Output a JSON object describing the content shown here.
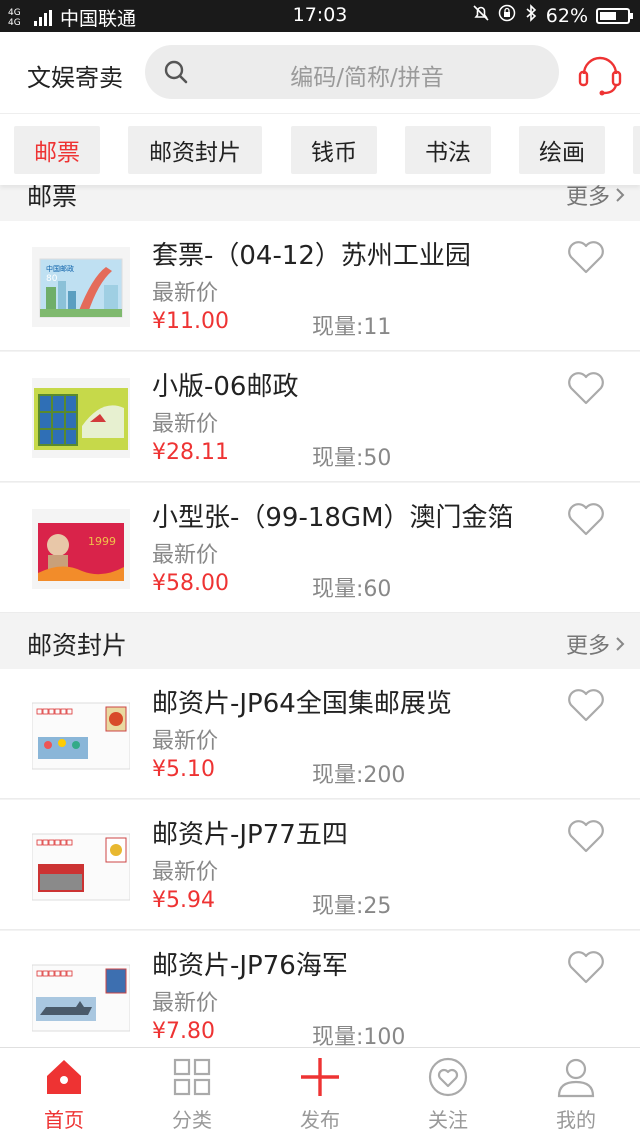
{
  "status_bar": {
    "network": "4G 4G",
    "carrier": "中国联通",
    "time": "17:03",
    "battery": "62%",
    "battery_level": 0.62
  },
  "header": {
    "brand": "文娱寄卖",
    "search_placeholder": "编码/简称/拼音"
  },
  "tabs": [
    {
      "label": "邮票",
      "active": true
    },
    {
      "label": "邮资封片",
      "active": false
    },
    {
      "label": "钱币",
      "active": false
    },
    {
      "label": "书法",
      "active": false
    },
    {
      "label": "绘画",
      "active": false
    }
  ],
  "sections": [
    {
      "title": "邮票",
      "more": "更多",
      "items": [
        {
          "title": "套票-（04-12）苏州工业园",
          "sub": "最新价",
          "price": "¥11.00",
          "stock": "现量:11"
        },
        {
          "title": "小版-06邮政",
          "sub": "最新价",
          "price": "¥28.11",
          "stock": "现量:50"
        },
        {
          "title": "小型张-（99-18GM）澳门金箔",
          "sub": "最新价",
          "price": "¥58.00",
          "stock": "现量:60"
        }
      ]
    },
    {
      "title": "邮资封片",
      "more": "更多",
      "items": [
        {
          "title": "邮资片-JP64全国集邮展览",
          "sub": "最新价",
          "price": "¥5.10",
          "stock": "现量:200"
        },
        {
          "title": "邮资片-JP77五四",
          "sub": "最新价",
          "price": "¥5.94",
          "stock": "现量:25"
        },
        {
          "title": "邮资片-JP76海军",
          "sub": "最新价",
          "price": "¥7.80",
          "stock": "现量:100"
        }
      ]
    }
  ],
  "stamp_text": {
    "stamp1_value": "80",
    "stamp3_year": "1999"
  },
  "bottom_nav": [
    {
      "label": "首页",
      "icon": "home-icon",
      "active": true
    },
    {
      "label": "分类",
      "icon": "grid-icon",
      "active": false
    },
    {
      "label": "发布",
      "icon": "plus-icon",
      "active": false
    },
    {
      "label": "关注",
      "icon": "heart-circle-icon",
      "active": false
    },
    {
      "label": "我的",
      "icon": "person-icon",
      "active": false
    }
  ],
  "colors": {
    "accent": "#e33333",
    "muted": "#888888",
    "background": "#f3f3f3"
  }
}
